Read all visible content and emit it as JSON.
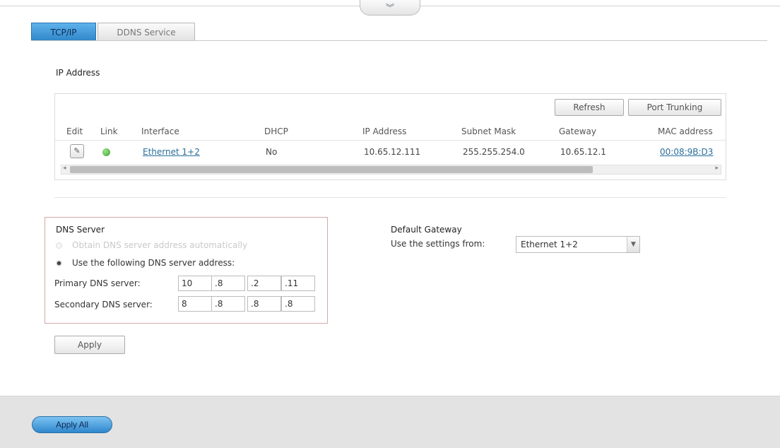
{
  "header": {
    "collapse_icon": "chevron-down-icon",
    "collapse_glyph": "︾"
  },
  "tabs": [
    {
      "label": "TCP/IP",
      "active": true
    },
    {
      "label": "DDNS Service",
      "active": false
    }
  ],
  "ip_section": {
    "title": "IP Address",
    "refresh_label": "Refresh",
    "port_trunking_label": "Port Trunking",
    "columns": [
      "Edit",
      "Link",
      "Interface",
      "DHCP",
      "IP Address",
      "Subnet Mask",
      "Gateway",
      "MAC address"
    ],
    "rows": [
      {
        "edit_icon": "edit-icon",
        "link_status": "green",
        "interface": "Ethernet 1+2",
        "dhcp": "No",
        "ip": "10.65.12.111",
        "subnet": "255.255.254.0",
        "gateway": "10.65.12.1",
        "mac": "00:08:9B:D3"
      }
    ]
  },
  "dns": {
    "title": "DNS Server",
    "option_auto": "Obtain DNS server address automatically",
    "option_manual": "Use the following DNS server address:",
    "primary_label": "Primary DNS server:",
    "secondary_label": "Secondary DNS server:",
    "primary": [
      "10",
      ".8",
      ".2",
      ".11"
    ],
    "secondary": [
      "8",
      ".8",
      ".8",
      ".8"
    ],
    "apply_label": "Apply"
  },
  "gateway": {
    "title": "Default Gateway",
    "label": "Use the settings from:",
    "selected": "Ethernet 1+2"
  },
  "footer": {
    "apply_all_label": "Apply All"
  },
  "colors": {
    "accent": "#2f86c8",
    "status_green": "#3aa12a",
    "dns_border": "#d3a8a8"
  }
}
